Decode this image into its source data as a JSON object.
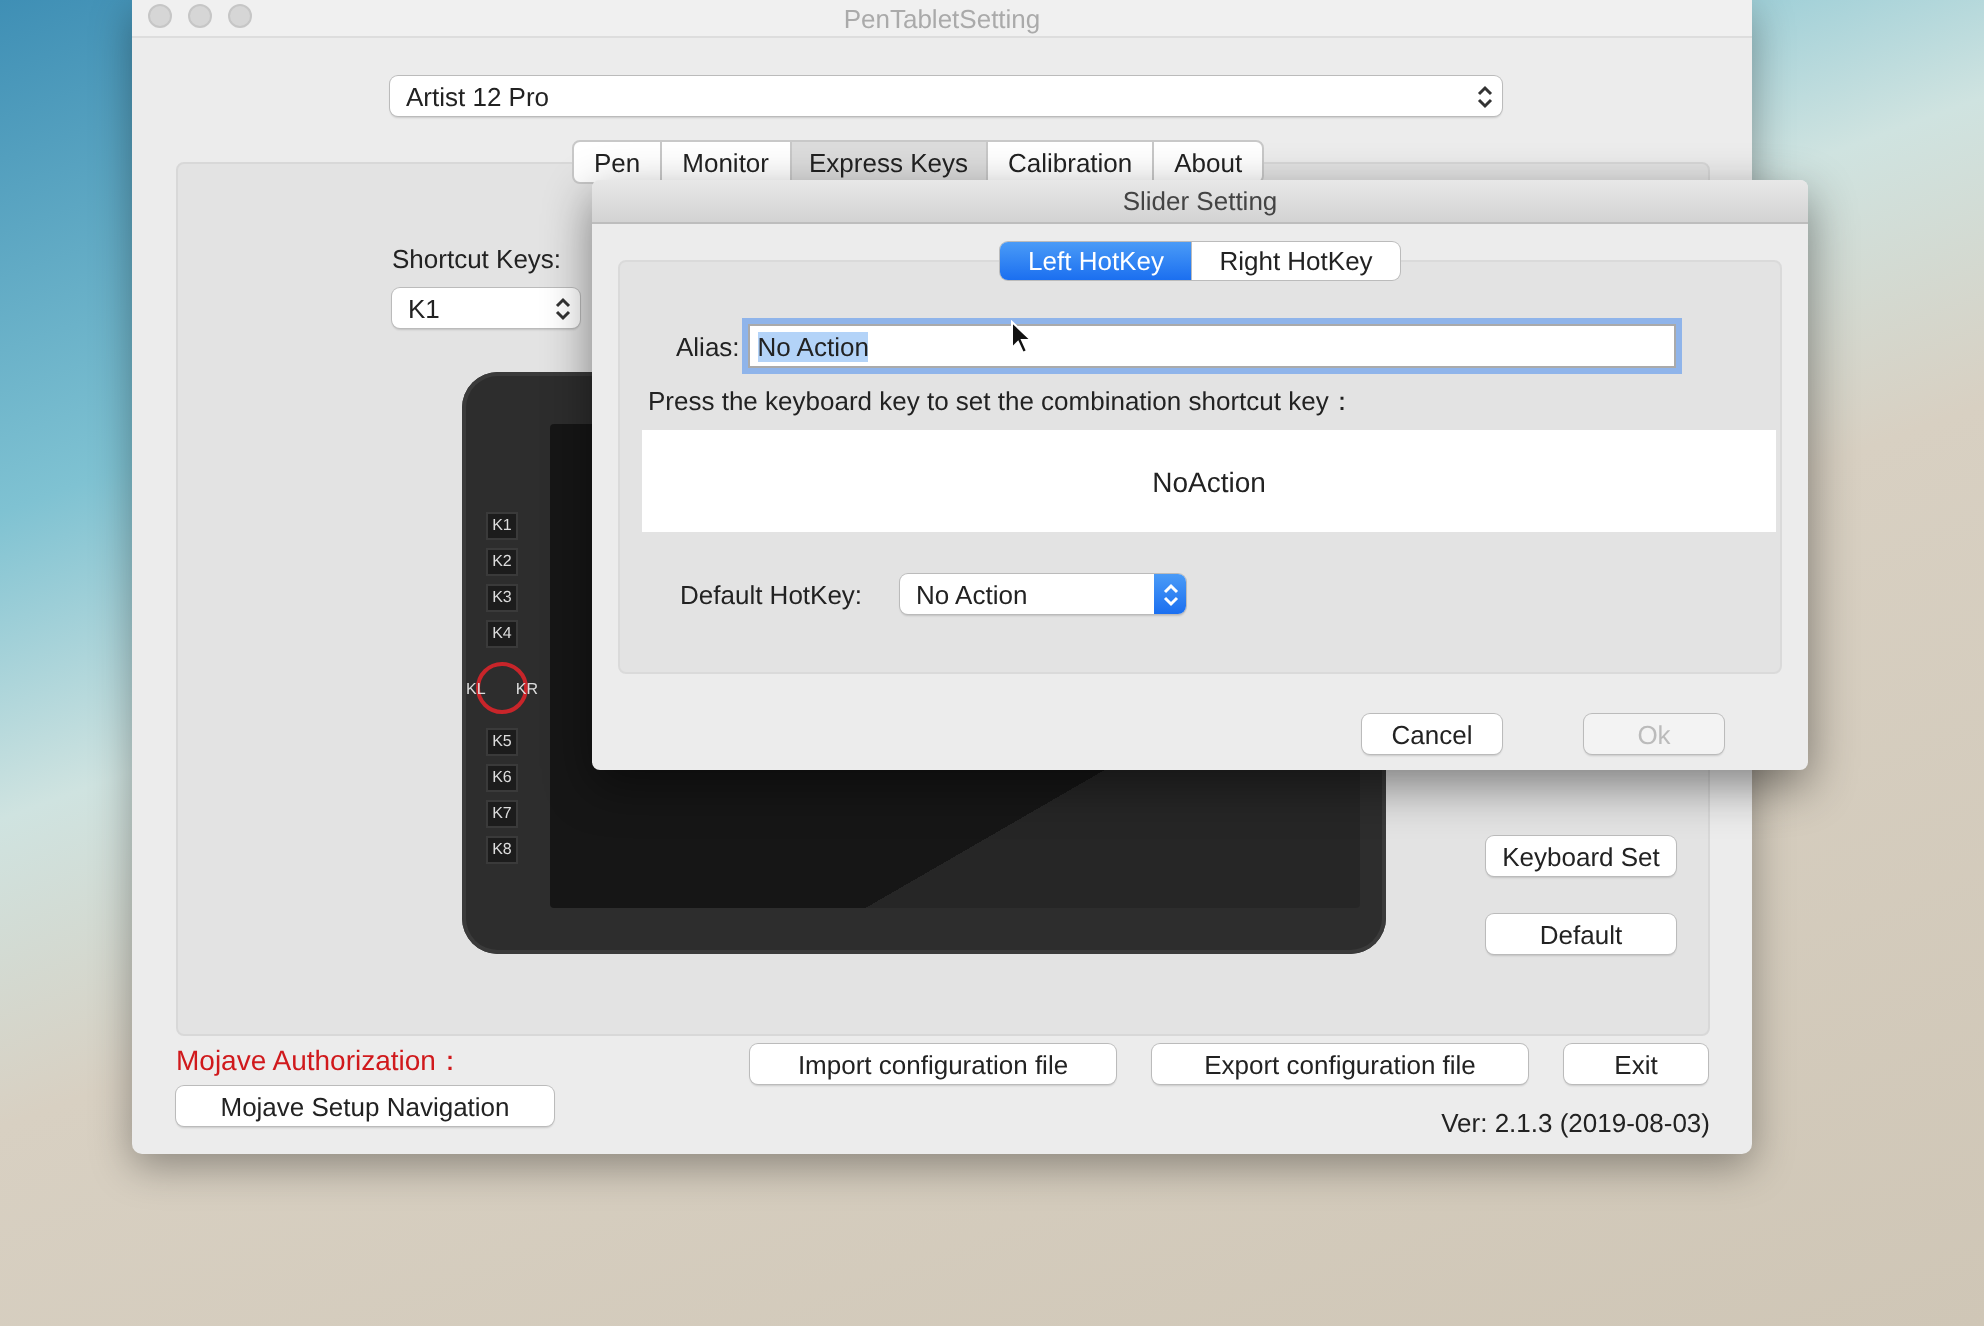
{
  "window": {
    "title": "PenTabletSetting"
  },
  "device_select": {
    "value": "Artist 12 Pro"
  },
  "tabs": [
    {
      "label": "Pen",
      "selected": false
    },
    {
      "label": "Monitor",
      "selected": false
    },
    {
      "label": "Express Keys",
      "selected": true
    },
    {
      "label": "Calibration",
      "selected": false
    },
    {
      "label": "About",
      "selected": false
    }
  ],
  "shortcut_keys": {
    "label": "Shortcut Keys:",
    "value": "K1"
  },
  "tablet": {
    "upper_keys": [
      "K1",
      "K2",
      "K3",
      "K4"
    ],
    "dial": [
      "KL",
      "KR"
    ],
    "lower_keys": [
      "K5",
      "K6",
      "K7",
      "K8"
    ]
  },
  "side_buttons": [
    "Keyboard Set",
    "Default"
  ],
  "mojave": {
    "label": "Mojave Authorization：",
    "button": "Mojave Setup Navigation"
  },
  "footer_buttons": [
    "Import configuration file",
    "Export configuration file",
    "Exit"
  ],
  "version": "Ver: 2.1.3 (2019-08-03)",
  "dialog": {
    "title": "Slider Setting",
    "tabs": [
      {
        "label": "Left HotKey",
        "selected": true
      },
      {
        "label": "Right HotKey",
        "selected": false
      }
    ],
    "alias": {
      "label": "Alias:",
      "value": "No Action",
      "highlighted": true
    },
    "prompt": "Press the keyboard key to set the combination shortcut key：",
    "combination": "NoAction",
    "default_hotkey": {
      "label": "Default HotKey:",
      "value": "No Action"
    },
    "buttons": [
      {
        "label": "Cancel",
        "disabled": false
      },
      {
        "label": "Ok",
        "disabled": true
      }
    ]
  }
}
